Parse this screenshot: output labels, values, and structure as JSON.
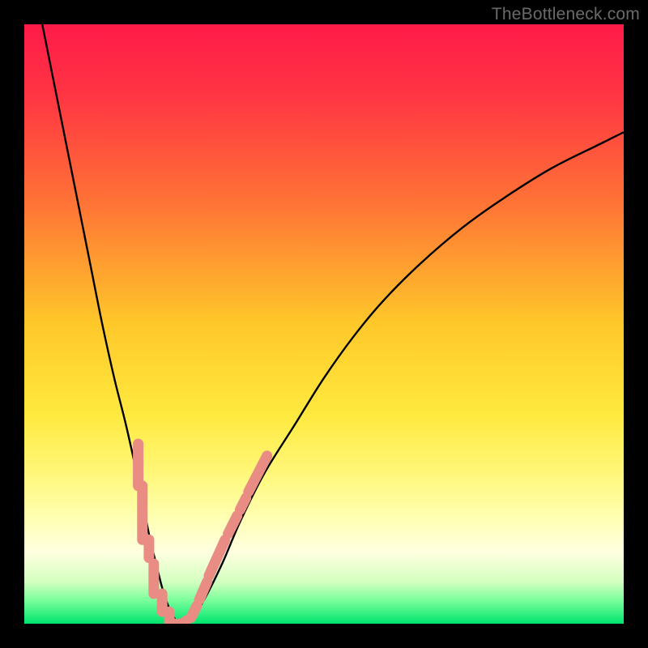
{
  "watermark": "TheBottleneck.com",
  "colors": {
    "black": "#000000",
    "curve": "#000000",
    "marker": "#e98c84",
    "gradient_stops": [
      {
        "pct": 0,
        "color": "#ff1b49"
      },
      {
        "pct": 12,
        "color": "#ff3543"
      },
      {
        "pct": 30,
        "color": "#ff7436"
      },
      {
        "pct": 50,
        "color": "#ffc82a"
      },
      {
        "pct": 65,
        "color": "#ffe93e"
      },
      {
        "pct": 75,
        "color": "#fff77a"
      },
      {
        "pct": 82,
        "color": "#ffffb0"
      },
      {
        "pct": 88,
        "color": "#ffffe0"
      },
      {
        "pct": 93,
        "color": "#d4ffc0"
      },
      {
        "pct": 96,
        "color": "#7dff9c"
      },
      {
        "pct": 100,
        "color": "#00e46e"
      }
    ]
  },
  "chart_data": {
    "type": "line",
    "title": "",
    "xlabel": "",
    "ylabel": "",
    "xlim": [
      0,
      100
    ],
    "ylim": [
      0,
      100
    ],
    "series": [
      {
        "name": "bottleneck-curve",
        "x": [
          3,
          5,
          7,
          9,
          11,
          13,
          15,
          17,
          19,
          20,
          21,
          22,
          23,
          24,
          25,
          26,
          28,
          30,
          33,
          36,
          40,
          45,
          50,
          55,
          60,
          66,
          73,
          80,
          88,
          96,
          100
        ],
        "y": [
          100,
          90,
          80,
          70,
          60,
          50,
          41,
          33,
          24,
          19,
          14,
          10,
          6,
          3,
          1,
          0,
          1,
          4,
          10,
          17,
          25,
          33,
          41,
          48,
          54,
          60,
          66,
          71,
          76,
          80,
          82
        ]
      }
    ],
    "markers": {
      "name": "highlight-points",
      "style": "rounded-capsule",
      "color": "#e98c84",
      "groups": [
        {
          "shape": "vertical-capsule",
          "points": [
            {
              "x": 19.0,
              "y_top": 30,
              "y_bot": 23
            },
            {
              "x": 19.7,
              "y_top": 23,
              "y_bot": 14
            },
            {
              "x": 20.8,
              "y_top": 14,
              "y_bot": 11
            },
            {
              "x": 21.6,
              "y_top": 10,
              "y_bot": 5
            },
            {
              "x": 23.0,
              "y_top": 5,
              "y_bot": 2
            },
            {
              "x": 24.2,
              "y_top": 2,
              "y_bot": 0
            }
          ]
        },
        {
          "shape": "dot",
          "points": [
            {
              "x": 25.0,
              "y": 0
            },
            {
              "x": 26.0,
              "y": 0
            },
            {
              "x": 27.0,
              "y": 0.5
            }
          ]
        },
        {
          "shape": "angled-capsule",
          "points": [
            {
              "x1": 27.8,
              "y1": 1,
              "x2": 28.8,
              "y2": 3
            },
            {
              "x1": 29.2,
              "y1": 4,
              "x2": 30.5,
              "y2": 7
            },
            {
              "x1": 30.8,
              "y1": 8,
              "x2": 33.5,
              "y2": 14
            },
            {
              "x1": 34.0,
              "y1": 15,
              "x2": 35.5,
              "y2": 18
            },
            {
              "x1": 36.0,
              "y1": 19,
              "x2": 37.0,
              "y2": 21
            },
            {
              "x1": 37.4,
              "y1": 22,
              "x2": 40.5,
              "y2": 28
            }
          ]
        }
      ]
    }
  }
}
